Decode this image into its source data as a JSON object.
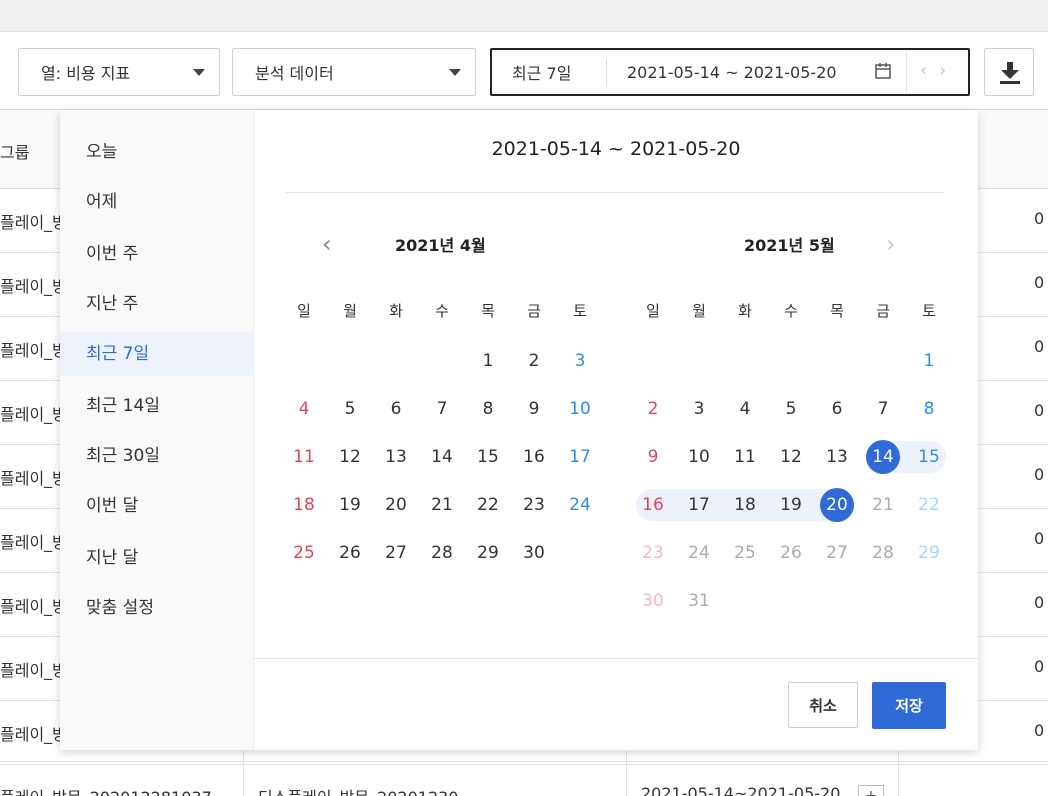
{
  "toolbar": {
    "column_select": "열: 비용 지표",
    "analysis_select": "분석 데이터",
    "range_preset": "최근 7일",
    "range_dates": "2021-05-14 ~ 2021-05-20"
  },
  "table": {
    "header_label": "그룹",
    "rows": [
      {
        "c1": "플레이_방",
        "value": "0"
      },
      {
        "c1": "플레이_방",
        "value": "0"
      },
      {
        "c1": "플레이_방",
        "value": "0"
      },
      {
        "c1": "플레이_방",
        "value": "0"
      },
      {
        "c1": "플레이_방",
        "value": "0"
      },
      {
        "c1": "플레이_방",
        "value": "0"
      },
      {
        "c1": "플레이_방",
        "value": "0"
      },
      {
        "c1": "플레이_방",
        "value": "0"
      },
      {
        "c1": "플레이_방",
        "value": "0"
      }
    ],
    "last_row": {
      "c1": "플레이_방문_202012281037",
      "c2": "디스플레이_방문_20201230",
      "c3": "2021-05-14~2021-05-20"
    }
  },
  "picker": {
    "presets": [
      "오늘",
      "어제",
      "이번 주",
      "지난 주",
      "최근 7일",
      "최근 14일",
      "최근 30일",
      "이번 달",
      "지난 달",
      "맞춤 설정"
    ],
    "active_preset": "최근 7일",
    "selected_range": "2021-05-14 ~ 2021-05-20",
    "weekdays": [
      "일",
      "월",
      "화",
      "수",
      "목",
      "금",
      "토"
    ],
    "months": [
      {
        "title": "2021년 4월",
        "first_weekday": 4,
        "days": 30
      },
      {
        "title": "2021년 5월",
        "first_weekday": 6,
        "days": 31
      }
    ],
    "range_start_day": 14,
    "range_end_day": 20,
    "cancel_label": "취소",
    "save_label": "저장"
  },
  "colors": {
    "accent": "#2f6ad7",
    "sunday": "#e0465a",
    "saturday": "#2f8ee8",
    "range_band": "#edf2fa"
  }
}
